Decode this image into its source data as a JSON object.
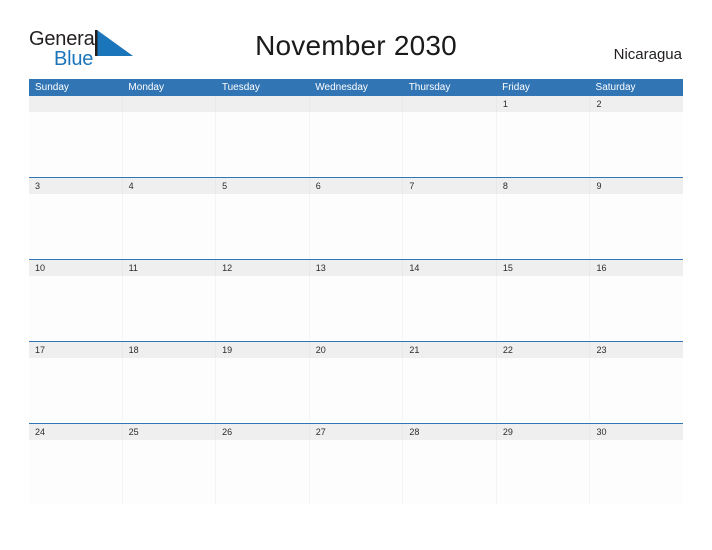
{
  "brand": {
    "name_part1": "General",
    "name_part2": "Blue",
    "flag_icon": "blue-triangle-flag-icon",
    "colors": {
      "general_text": "#231f20",
      "blue_text": "#1b75bb",
      "flag": "#1b75bb"
    }
  },
  "header": {
    "title": "November 2030",
    "region": "Nicaragua"
  },
  "calendar": {
    "colors": {
      "weekday_header_bg": "#3275b5",
      "weekday_header_text": "#ffffff",
      "daynum_strip_bg": "#efefef",
      "row_top_line": "#3275b5",
      "cell_bg": "#fdfdfd",
      "daynum_text": "#2b2b2b"
    },
    "weekdays": [
      "Sunday",
      "Monday",
      "Tuesday",
      "Wednesday",
      "Thursday",
      "Friday",
      "Saturday"
    ],
    "weeks": [
      {
        "days": [
          "",
          "",
          "",
          "",
          "",
          "1",
          "2"
        ]
      },
      {
        "days": [
          "3",
          "4",
          "5",
          "6",
          "7",
          "8",
          "9"
        ]
      },
      {
        "days": [
          "10",
          "11",
          "12",
          "13",
          "14",
          "15",
          "16"
        ]
      },
      {
        "days": [
          "17",
          "18",
          "19",
          "20",
          "21",
          "22",
          "23"
        ]
      },
      {
        "days": [
          "24",
          "25",
          "26",
          "27",
          "28",
          "29",
          "30"
        ]
      }
    ]
  }
}
